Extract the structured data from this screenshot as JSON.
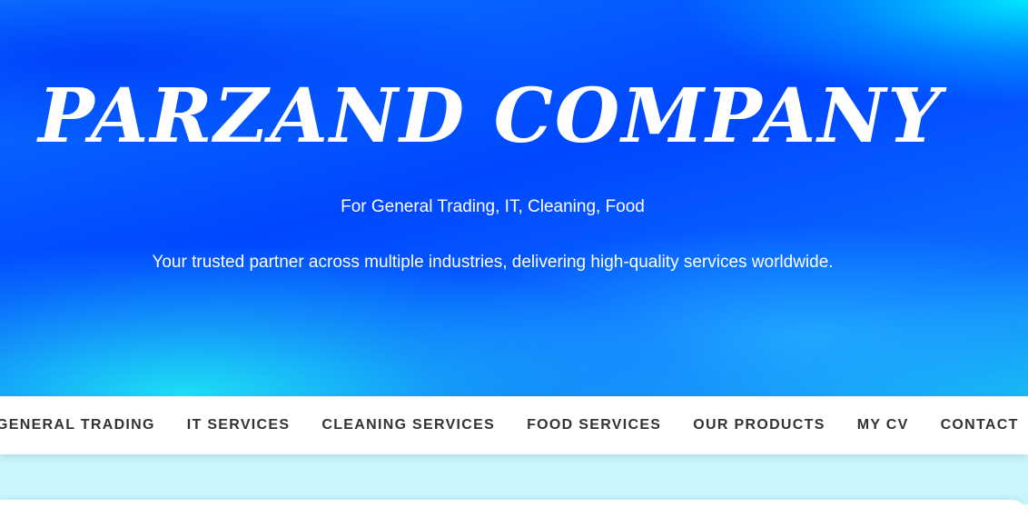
{
  "hero": {
    "title": "PARZAND COMPANY",
    "subtitle": "For General Trading, IT, Cleaning, Food",
    "tagline": "Your trusted partner across multiple industries, delivering high-quality services worldwide."
  },
  "nav": {
    "items": [
      {
        "label": "GENERAL TRADING"
      },
      {
        "label": "IT SERVICES"
      },
      {
        "label": "CLEANING SERVICES"
      },
      {
        "label": "FOOD SERVICES"
      },
      {
        "label": "OUR PRODUCTS"
      },
      {
        "label": "MY CV"
      },
      {
        "label": "CONTACT"
      }
    ]
  },
  "colors": {
    "hero_primary": "#0047ff",
    "hero_accent": "#00e6ff",
    "content_background": "#c9f5fd",
    "nav_text": "#333333"
  }
}
